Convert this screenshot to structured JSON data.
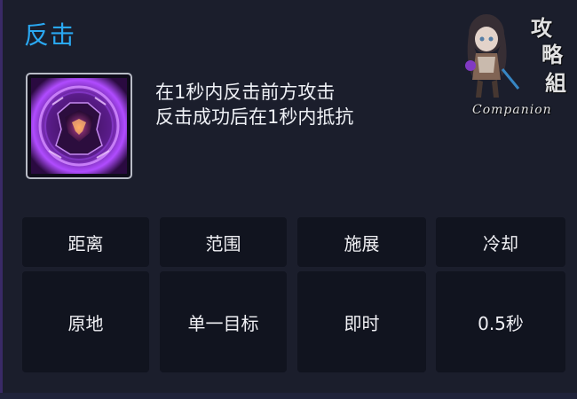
{
  "skill": {
    "name": "反击",
    "icon": "counter-armor-purple-icon",
    "description": [
      "在1秒内反击前方攻击",
      "反击成功后在1秒内抵抗"
    ]
  },
  "stats": {
    "headers": [
      "距离",
      "范围",
      "施展",
      "冷却"
    ],
    "values": [
      "原地",
      "单一目标",
      "即时",
      "0.5秒"
    ]
  },
  "watermark": {
    "glyphs": [
      "攻",
      "略",
      "組"
    ],
    "label": "Companion"
  },
  "colors": {
    "title": "#2aa8f2",
    "background": "#1b1e2c",
    "cell": "#11141f",
    "icon_glow": "#b04cff"
  }
}
